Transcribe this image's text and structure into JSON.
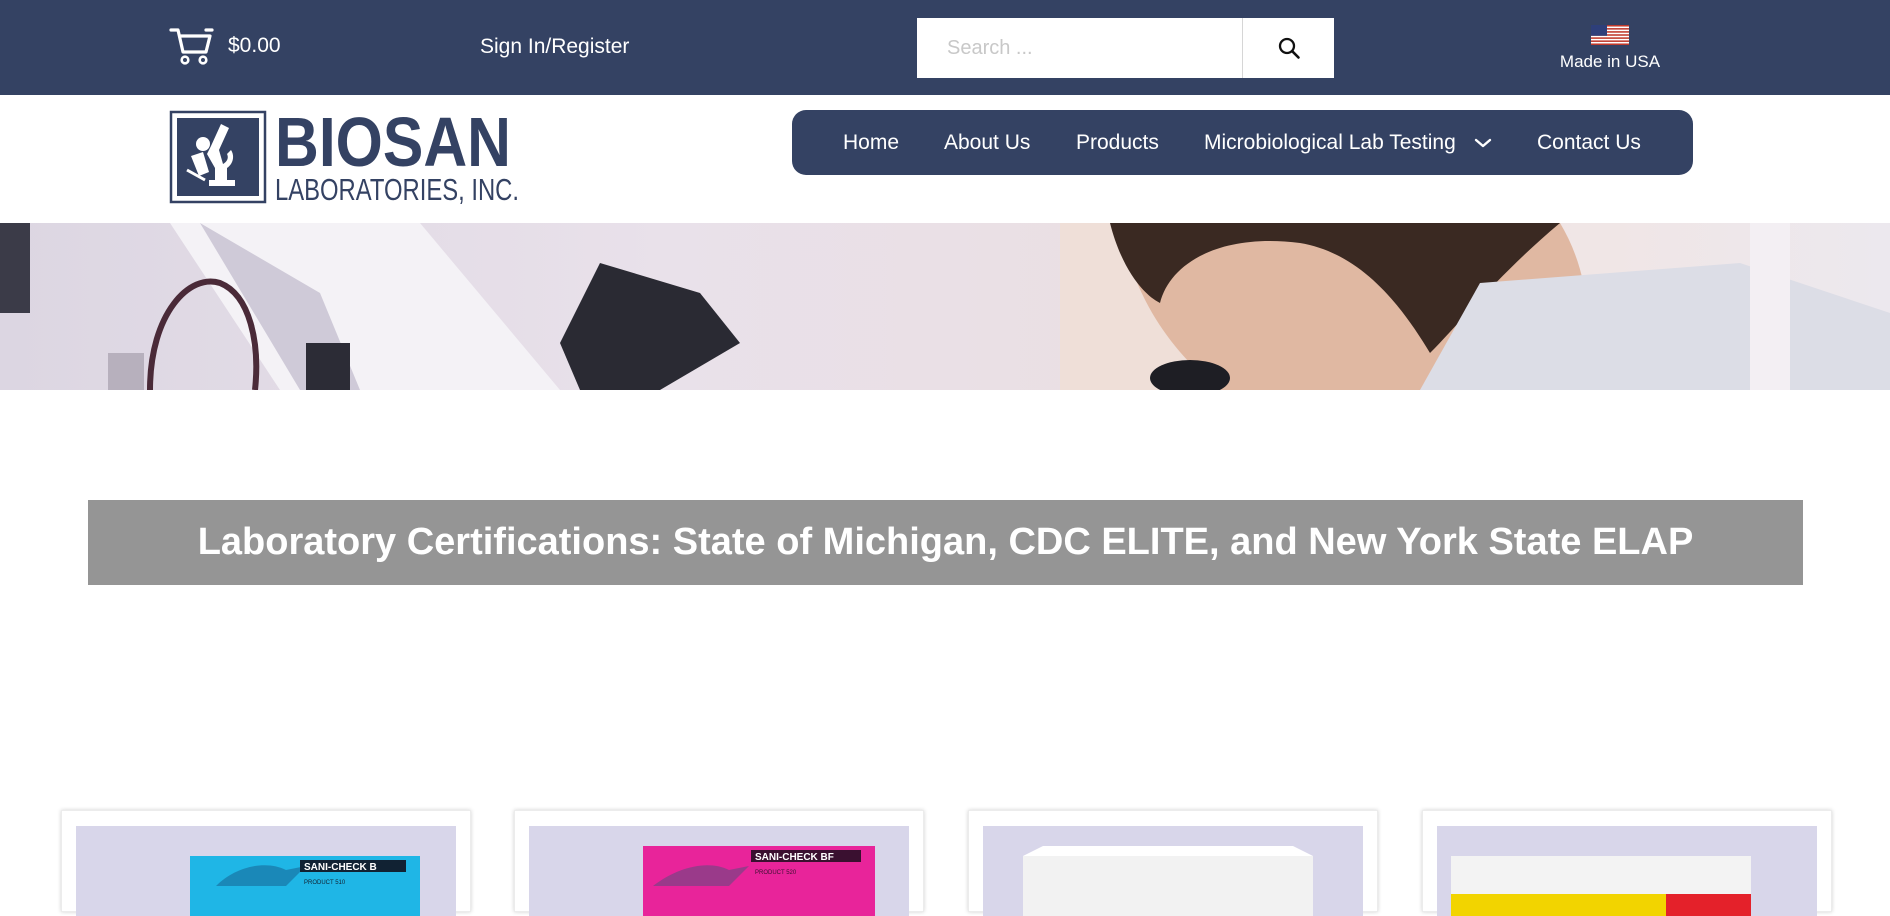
{
  "header": {
    "cart_total": "$0.00",
    "sign_in_label": "Sign In/Register",
    "search": {
      "placeholder": "Search ..."
    },
    "badge_label": "Made in USA"
  },
  "logo": {
    "line1": "BIOSAN",
    "line2": "LABORATORIES, INC."
  },
  "nav": {
    "items": [
      {
        "label": "Home"
      },
      {
        "label": "About Us"
      },
      {
        "label": "Products"
      },
      {
        "label": "Microbiological Lab Testing"
      },
      {
        "label": "Contact Us"
      }
    ]
  },
  "main": {
    "heading": "Laboratory Certifications: State of Michigan, CDC ELITE, and New York State ELAP"
  },
  "products": [
    {
      "box_label": "SANI-CHECK B",
      "product_no": "PRODUCT 510",
      "color": "#1fb6e6"
    },
    {
      "box_label": "SANI-CHECK BF",
      "product_no": "PRODUCT 520",
      "color": "#e8249a"
    },
    {
      "box_label": "",
      "product_no": "",
      "color": "#f2f2f2"
    },
    {
      "box_label": "",
      "product_no": "",
      "color": "#f3f3f3"
    }
  ],
  "colors": {
    "brand_navy": "#344263",
    "banner_gray": "#959595"
  },
  "icons": [
    "cart-icon",
    "search-icon",
    "us-flag-icon",
    "chevron-down-icon"
  ]
}
